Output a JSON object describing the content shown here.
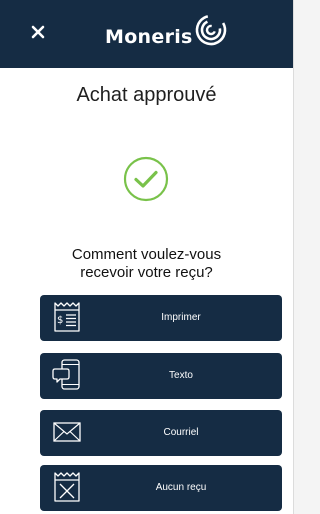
{
  "header": {
    "close_icon": "close-icon",
    "logo_text": "Moneris"
  },
  "main": {
    "title": "Achat approuvé",
    "status_icon": "check-circle-icon",
    "question_line1": "Comment voulez-vous",
    "question_line2": "recevoir votre reçu?"
  },
  "receipt_options": [
    {
      "label": "Imprimer",
      "icon": "printer-receipt-icon"
    },
    {
      "label": "Texto",
      "icon": "phone-message-icon"
    },
    {
      "label": "Courriel",
      "icon": "envelope-icon"
    },
    {
      "label": "Aucun reçu",
      "icon": "no-receipt-icon"
    }
  ],
  "colors": {
    "brand_navy": "#152c44",
    "success_green": "#79c24a",
    "text_dark": "#1f1f1f"
  }
}
